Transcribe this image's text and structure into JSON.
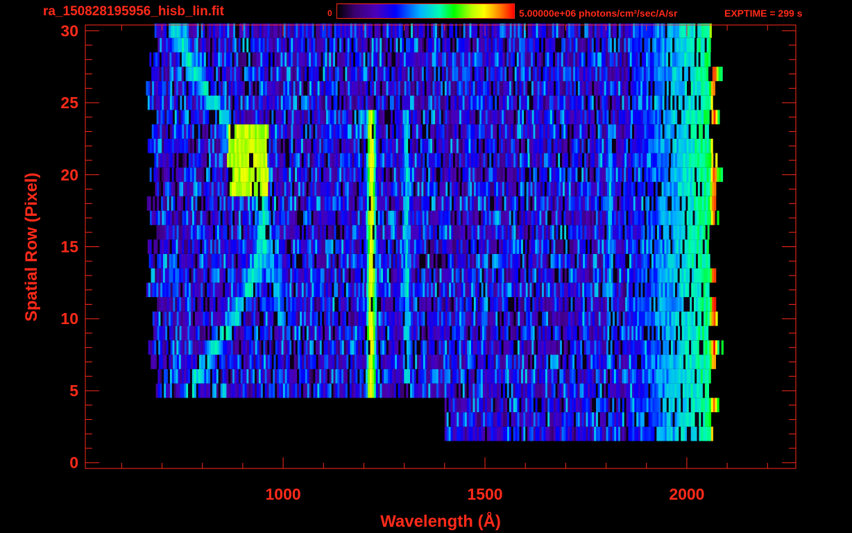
{
  "header": {
    "file_title": "ra_150828195956_hisb_lin.fit",
    "colorbar_min_label": "0",
    "colorbar_max_label": "5.00000e+06 photons/cm²/sec/A/sr",
    "exptime_label": "EXPTIME = 299 s"
  },
  "colors": {
    "axis": "#ff2a1a",
    "background": "#000000",
    "colormap": [
      "#000000",
      "#3a0070",
      "#4b00b8",
      "#0000ff",
      "#00b4ff",
      "#00ffb0",
      "#00ff00",
      "#b8ff00",
      "#ffff00",
      "#ff8000",
      "#ff0000"
    ]
  },
  "chart_data": {
    "type": "heatmap",
    "title": "",
    "xlabel": "Wavelength (Å)",
    "ylabel": "Spatial Row (Pixel)",
    "xlim": [
      510,
      2270
    ],
    "ylim": [
      -0.4,
      30.4
    ],
    "x_ticks": [
      1000,
      1500,
      2000
    ],
    "y_ticks": [
      0,
      5,
      10,
      15,
      20,
      25,
      30
    ],
    "x_tick_labels": [
      "1000",
      "1500",
      "2000"
    ],
    "y_tick_labels": [
      "0",
      "5",
      "10",
      "15",
      "20",
      "25",
      "30"
    ],
    "x_minor_step": 100,
    "y_minor_step": 1,
    "colorbar_range": [
      0,
      5000000
    ],
    "colorbar_units": "photons/cm²/sec/A/sr",
    "rows": [
      2,
      30
    ],
    "wavelength_range": [
      675,
      2090
    ],
    "features": [
      {
        "kind": "emission_line",
        "wavelength": 1216,
        "rows": [
          5,
          24
        ],
        "level": 0.78
      },
      {
        "kind": "emission_line",
        "wavelength": 1304,
        "rows": [
          6,
          24
        ],
        "level": 0.45
      },
      {
        "kind": "emission_line",
        "wavelength": 1808,
        "rows": [
          7,
          23
        ],
        "level": 0.42
      },
      {
        "kind": "emission_line",
        "wavelength": 2065,
        "rows": [
          2,
          30
        ],
        "level": 0.95
      },
      {
        "kind": "diffuse_arc",
        "wavelength_range": [
          800,
          1060
        ],
        "rows": [
          8,
          24
        ],
        "level": 0.55
      }
    ]
  }
}
